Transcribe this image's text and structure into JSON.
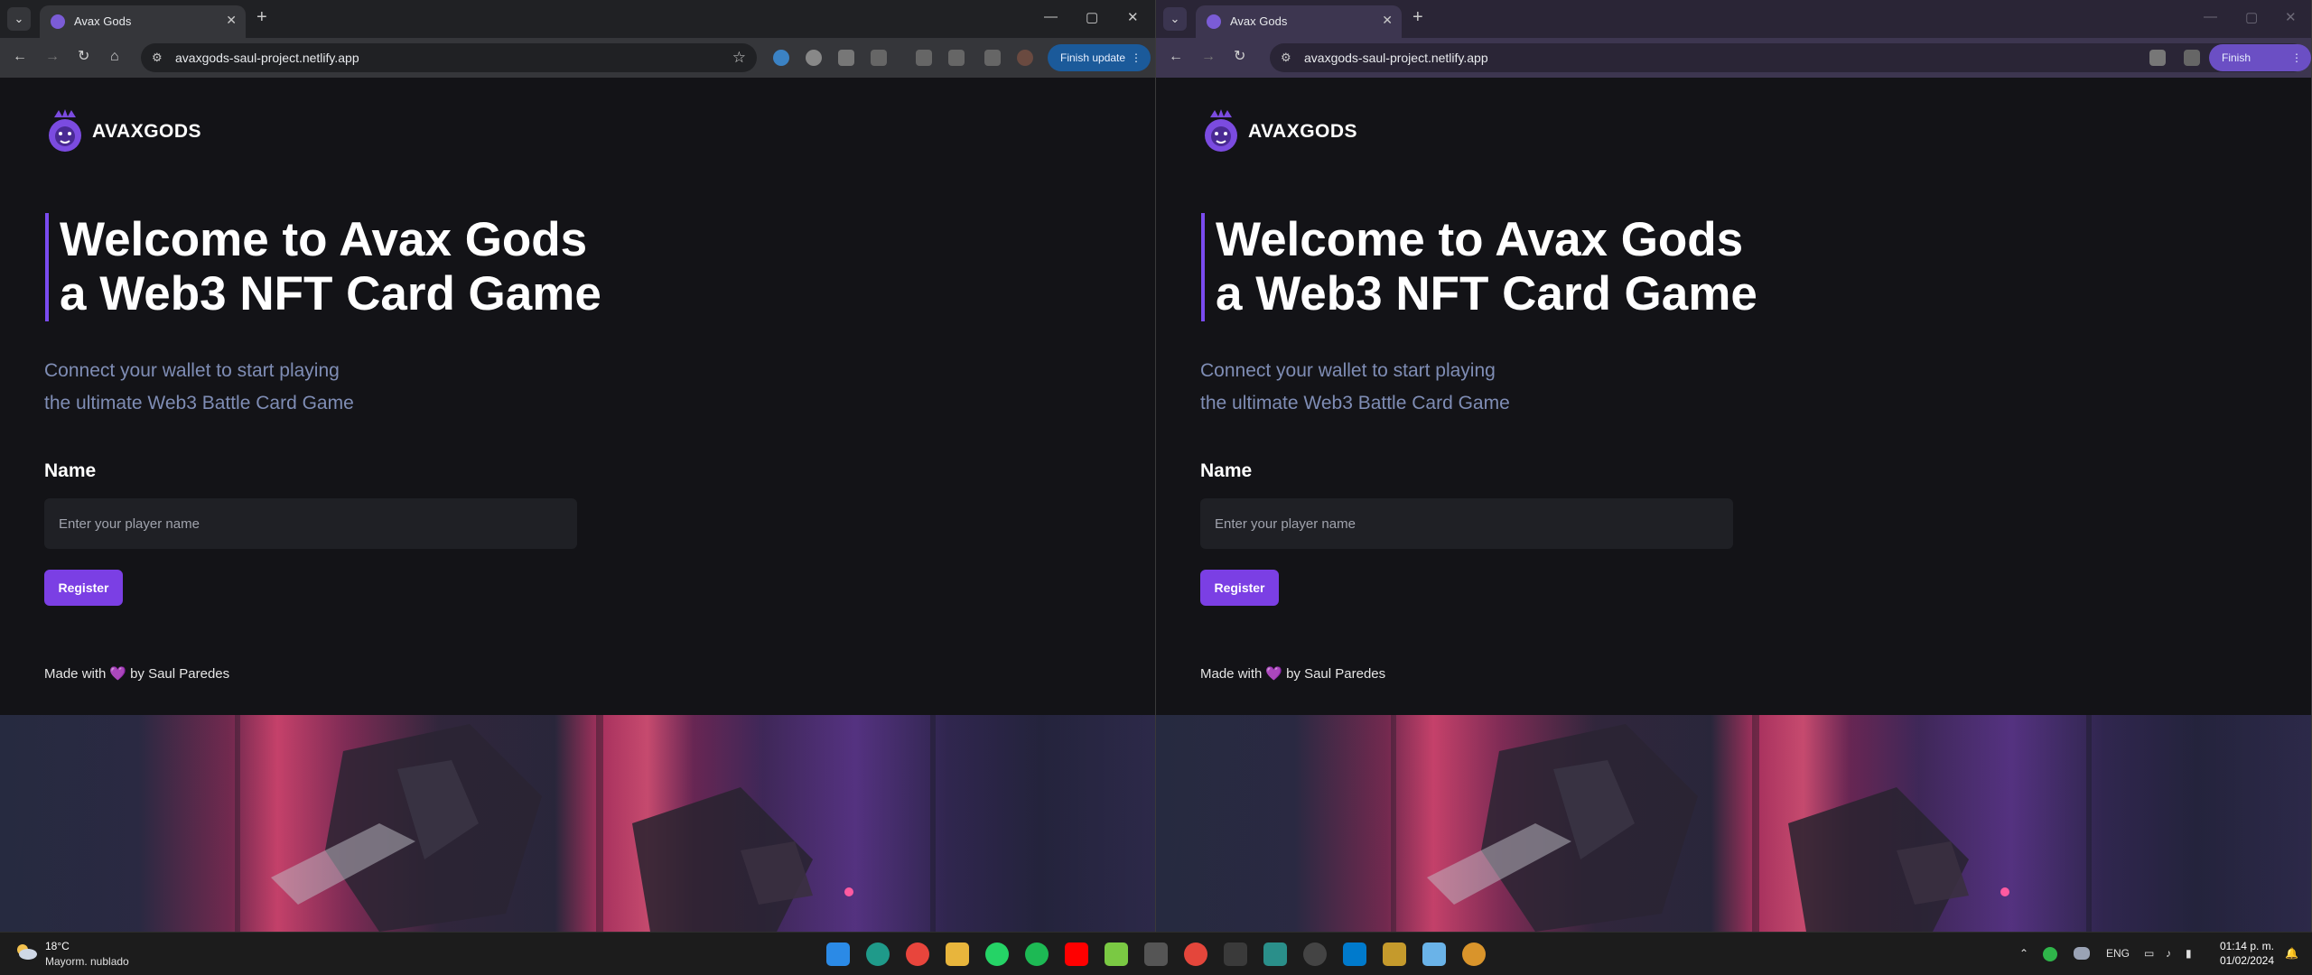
{
  "browser": {
    "tab_title": "Avax Gods",
    "url": "avaxgods-saul-project.netlify.app",
    "finish_update_label": "Finish update"
  },
  "page": {
    "logo_text": "AVAXGODS",
    "hero_line1": "Welcome to Avax Gods",
    "hero_line2": "a Web3 NFT Card Game",
    "sub_line1": "Connect your wallet to start playing",
    "sub_line2": "the ultimate Web3 Battle Card Game",
    "name_label": "Name",
    "name_placeholder": "Enter your player name",
    "register_label": "Register",
    "made_with": "Made with",
    "heart": "💜",
    "author": "by Saul Paredes"
  },
  "taskbar": {
    "temperature": "18°C",
    "weather_condition": "Mayorm. nublado",
    "language": "ENG",
    "time": "01:14 p. m.",
    "date": "01/02/2024"
  },
  "colors": {
    "accent": "#7b3fe4",
    "page_bg": "#131317",
    "subtitle": "#7f8db5"
  }
}
